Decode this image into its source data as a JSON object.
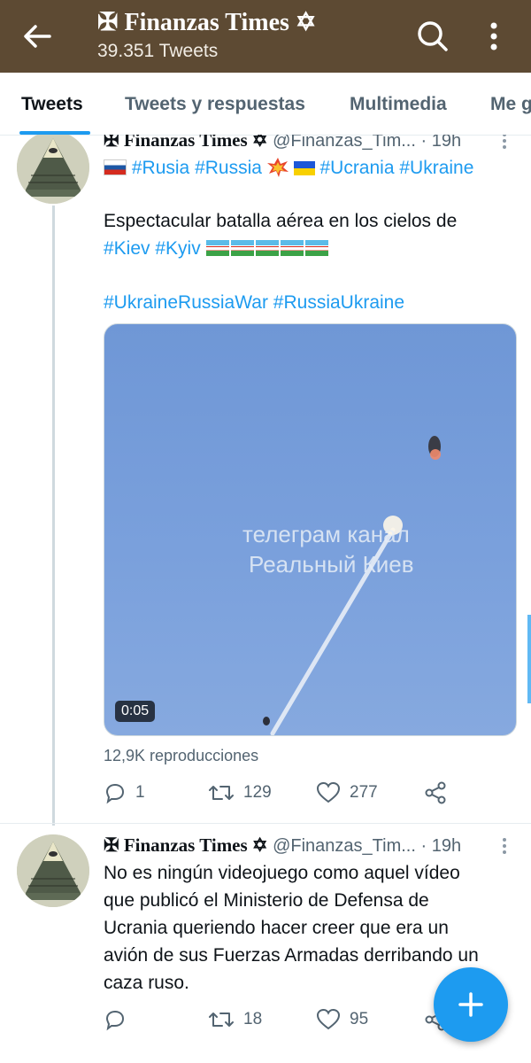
{
  "header": {
    "title": "✠ Finanzas Times ✡",
    "tweet_count": "39.351 Tweets",
    "back_icon": "arrow-left-icon",
    "search_icon": "search-icon",
    "more_icon": "kebab-menu-icon"
  },
  "tabs": [
    {
      "label": "Tweets",
      "active": true
    },
    {
      "label": "Tweets y respuestas",
      "active": false
    },
    {
      "label": "Multimedia",
      "active": false
    },
    {
      "label": "Me g",
      "active": false
    }
  ],
  "tweets": [
    {
      "name": "✠ Finanzas Times ✡",
      "handle": "@Finanzas_Tim...",
      "time": "· 19h",
      "line1_hashtags": [
        "#Rusia",
        "#Russia",
        "#Ucrania",
        "#Ukraine"
      ],
      "line2": "Espectacular batalla aérea en los cielos de",
      "line3_hashtags": [
        "#Kiev",
        "#Kyiv"
      ],
      "line4_hashtags": [
        "#UkraineRussiaWar",
        "#RussiaUkraine"
      ],
      "media": {
        "overlay_line1": "телеграм канал",
        "overlay_line2": "Реальный Киев",
        "duration": "0:05"
      },
      "views": "12,9K reproducciones",
      "replies": "1",
      "retweets": "129",
      "likes": "277"
    },
    {
      "name": "✠ Finanzas Times ✡",
      "handle": "@Finanzas_Tim...",
      "time": "· 19h",
      "text_lines": [
        "No es ningún videojuego como aquel vídeo",
        "que publicó el Ministerio de Defensa de",
        "Ucrania queriendo hacer creer que era un",
        "avión de sus Fuerzas Armadas derribando un",
        "caza ruso."
      ],
      "replies": "",
      "retweets": "18",
      "likes": "95"
    }
  ],
  "colors": {
    "header_bg": "#5d4a33",
    "accent": "#1d9bf0",
    "muted": "#536471"
  }
}
